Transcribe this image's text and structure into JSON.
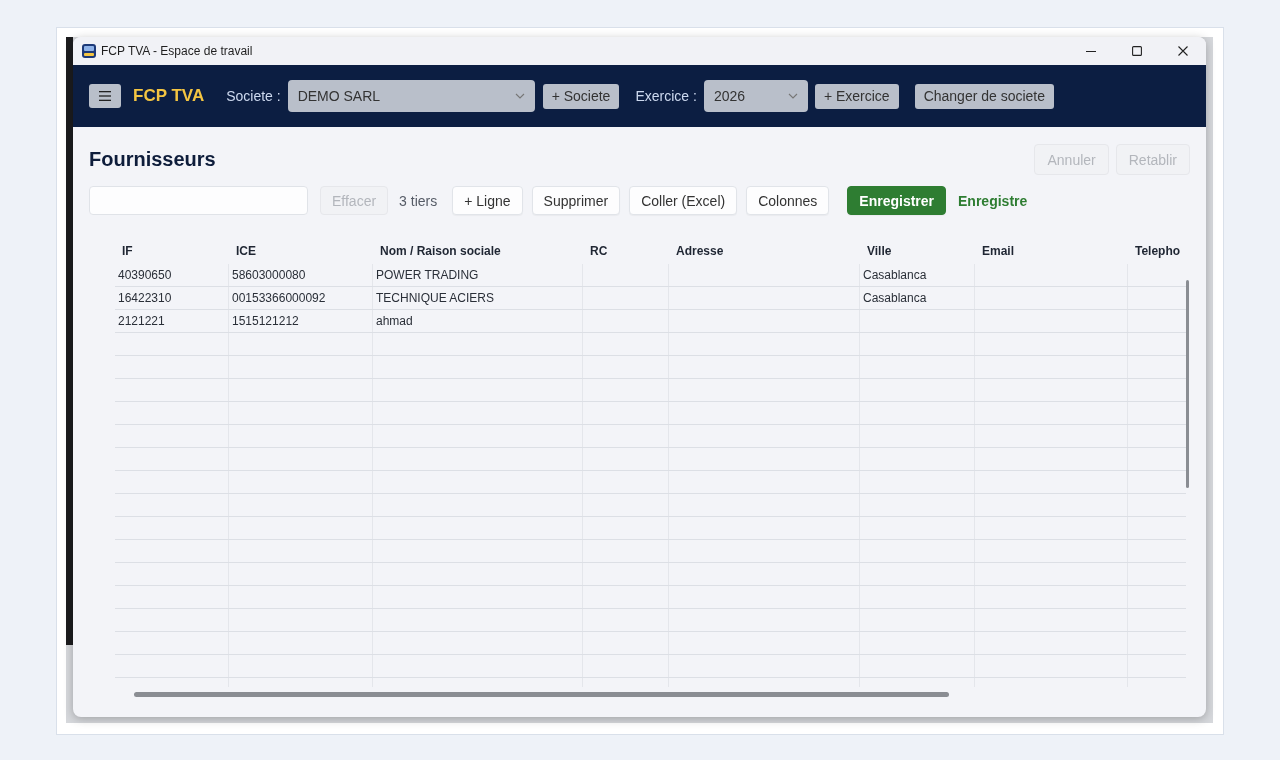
{
  "window": {
    "title": "FCP TVA - Espace de travail"
  },
  "header": {
    "brand": "FCP TVA",
    "company_label": "Societe :",
    "company_select": {
      "value": "DEMO SARL"
    },
    "add_company_button": "+ Societe",
    "fiscal_year_label": "Exercice :",
    "fiscal_year_select": {
      "value": "2026"
    },
    "add_fiscal_year_button": "+ Exercice",
    "change_company_button": "Changer de societe"
  },
  "page": {
    "title": "Fournisseurs",
    "history_buttons": [
      {
        "label": "Annuler",
        "disabled": true
      },
      {
        "label": "Retablir",
        "disabled": true
      }
    ]
  },
  "toolbar": {
    "clear_button": {
      "label": "Effacer",
      "disabled": true
    },
    "count": "3 tiers",
    "actions": [
      {
        "label": "+ Ligne",
        "kind": "default"
      },
      {
        "label": "Supprimer",
        "kind": "default"
      },
      {
        "label": "Coller (Excel)",
        "kind": "default"
      },
      {
        "label": "Colonnes",
        "kind": "default"
      },
      {
        "label": "Enregistrer",
        "kind": "primary"
      }
    ],
    "save_status": "Enregistre"
  },
  "table": {
    "columns": [
      "IF",
      "ICE",
      "Nom / Raison sociale",
      "RC",
      "Adresse",
      "Ville",
      "Email",
      "Telepho"
    ],
    "rows": [
      {
        "if": "40390650",
        "ice": "58603000080",
        "nom_raison_sociale": "POWER TRADING",
        "ville": "Casablanca"
      },
      {
        "if": "16422310",
        "ice": "00153366000092",
        "nom_raison_sociale": "TECHNIQUE ACIERS",
        "ville": "Casablanca"
      },
      {
        "if": "2121221",
        "ice": "1515121212",
        "nom_raison_sociale": "ahmad"
      }
    ]
  }
}
